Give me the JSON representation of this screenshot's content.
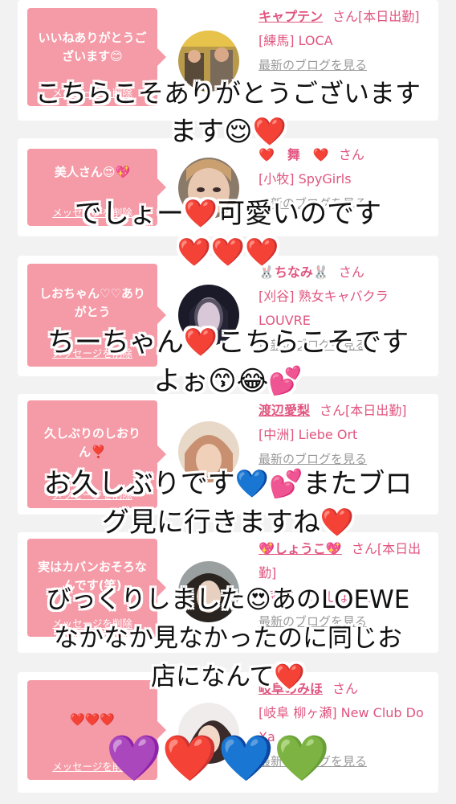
{
  "messages": [
    {
      "bubble": "いいねありがとうございます😊",
      "delete": "メッセージを削除",
      "name": "キャプテン",
      "san": "さん[本日出勤]",
      "shop": "[練馬] LOCA",
      "blog": "最新のブログを見る"
    },
    {
      "bubble": "美人さん😍💖",
      "delete": "メッセージを削除",
      "name": "❤️　舞　❤️",
      "san": "さん",
      "shop": "[小牧] SpyGirls",
      "blog": "最新のブログを見る"
    },
    {
      "bubble": "しおちゃん♡♡ありがとう",
      "delete": "メッセージを削除",
      "name": "🐰ちなみ🐰",
      "san": "さん",
      "shop": "[刈谷] 熟女キャバクラLOUVRE",
      "blog": "最新のブログを見る"
    },
    {
      "bubble": "久しぶりのしおりん❣️",
      "delete": "メッセージを削除",
      "name": "渡辺愛梨",
      "san": "さん[本日出勤]",
      "shop": "[中洲] Liebe Ort",
      "blog": "最新のブログを見る"
    },
    {
      "bubble": "実はカバンおそろなんです(笑)",
      "delete": "メッセージを削除",
      "name": "💖しょうこ💖",
      "san": "さん[本日出勤]",
      "shop": "[銀座] Mrs.しょうこ",
      "blog": "最新のブログを見る"
    },
    {
      "bubble": "❤️❤️❤️",
      "delete": "メッセージを削除",
      "name": "岐阜のみほ",
      "san": "さん",
      "shop": "[岐阜 柳ヶ瀬] New Club Do Xa",
      "blog": "最新のブログを見る"
    }
  ],
  "overlays": [
    {
      "line1": "こちらこそありがとうございます",
      "line2": "ます😌❤️"
    },
    {
      "line1": "でしょー❤️可愛いのです",
      "line2": "❤️❤️❤️"
    },
    {
      "line1": "ちーちゃん❤️こちらこそです",
      "line2": "よぉ😙😂💕"
    },
    {
      "line1": "お久しぶりです💙💕またブロ",
      "line2": "グ見に行きますね❤️"
    },
    {
      "line1": "びっくりしました😍あのLOEWE",
      "line2": "なかなか見なかったのに同じお",
      "line3": "店になんて❤️"
    }
  ],
  "bottom_hearts": "💜❤️💙💚",
  "colors": {
    "accent": "#e05580",
    "bubble": "#f59aa7",
    "background": "#f2f2f2"
  }
}
